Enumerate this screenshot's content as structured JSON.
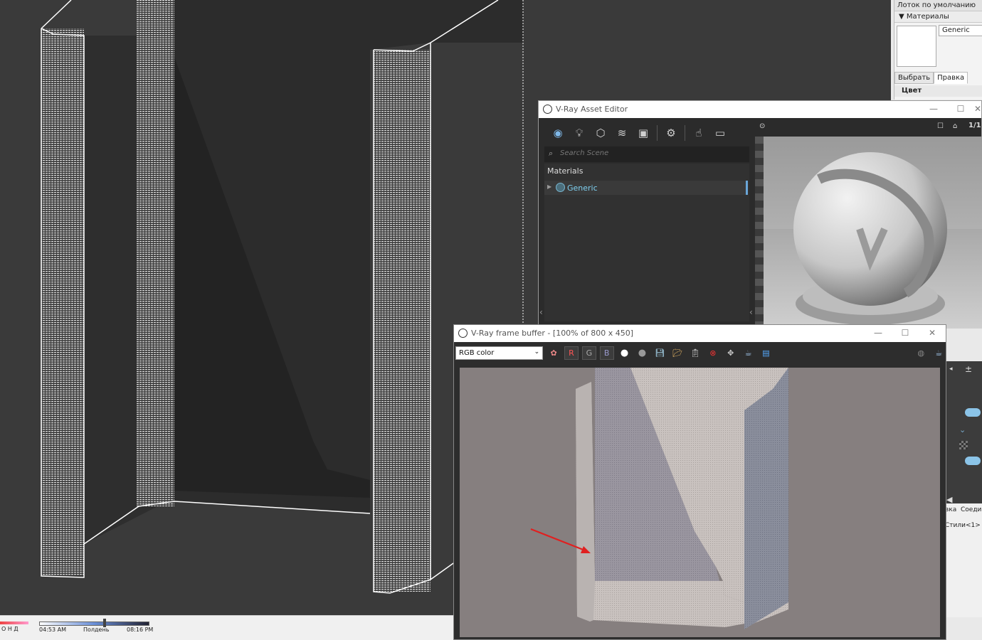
{
  "tray": {
    "title": "Лоток по умолчанию",
    "section_materials": "Материалы",
    "material_name": "Generic",
    "tabs": [
      "Выбрать",
      "Правка"
    ],
    "color_label": "Цвет"
  },
  "timebar": {
    "months": "О  Н  Д",
    "time_start": "04:53 AM",
    "noon": "Полдень",
    "time_end": "08:16 PM"
  },
  "side_panel": {
    "tab_a": "вка",
    "tab_b": "Соеди",
    "styles": "Стили<1>"
  },
  "asset_editor": {
    "title": "V-Ray Asset Editor",
    "search_placeholder": "Search Scene",
    "tree_header": "Materials",
    "items": [
      {
        "label": "Generic"
      }
    ],
    "preview_ratio": "1/1",
    "accent": "#7fd0f0"
  },
  "frame_buffer": {
    "title": "V-Ray frame buffer - [100% of 800 x 450]",
    "channel": "RGB color",
    "channels": {
      "r": "R",
      "g": "G",
      "b": "B"
    }
  },
  "annotation": {
    "arrow_color": "#e02020"
  }
}
